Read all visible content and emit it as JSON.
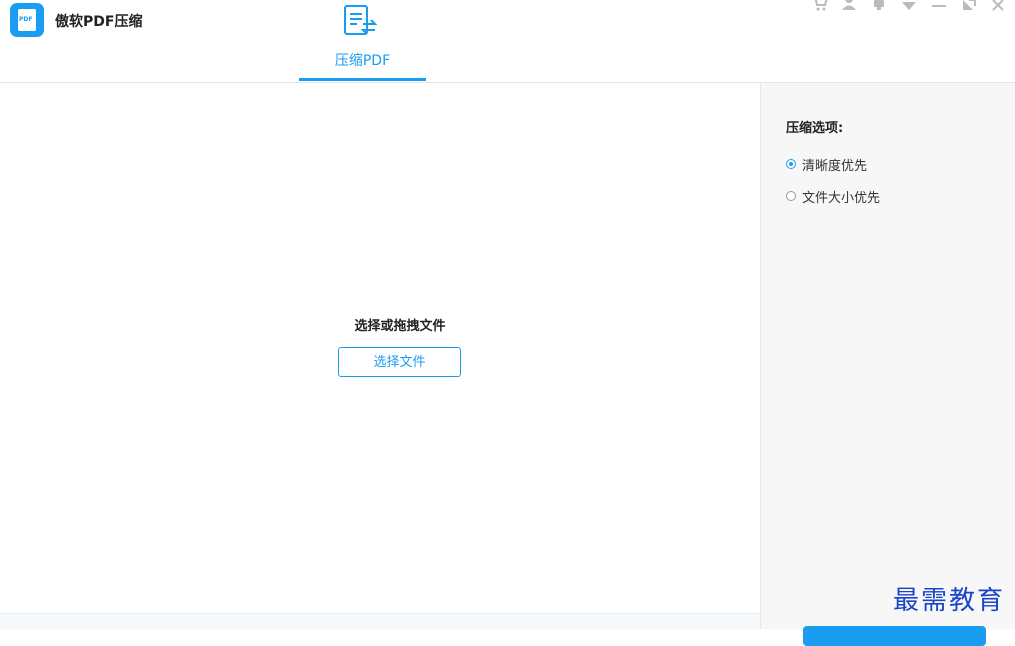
{
  "app": {
    "title": "傲软PDF压缩",
    "logo_text": "PDF"
  },
  "header": {
    "tabs": [
      {
        "label": "压缩PDF",
        "icon": "document-compress-icon",
        "active": true
      }
    ],
    "controls": [
      "cart-icon",
      "user-icon",
      "bell-icon",
      "dropdown-icon",
      "minimize-icon",
      "restore-icon",
      "close-icon"
    ]
  },
  "main": {
    "drop_title": "选择或拖拽文件",
    "select_button": "选择文件"
  },
  "sidebar": {
    "options_title": "压缩选项:",
    "options": [
      {
        "label": "清晰度优先",
        "selected": true
      },
      {
        "label": "文件大小优先",
        "selected": false
      }
    ]
  },
  "watermark": "最需教育",
  "colors": {
    "accent": "#1a9df0",
    "sidebar_bg": "#f7f7f7"
  }
}
